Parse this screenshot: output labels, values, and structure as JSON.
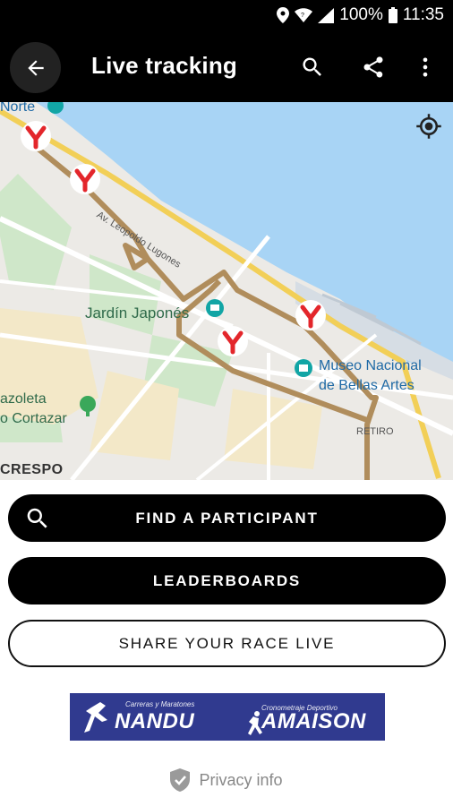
{
  "status_bar": {
    "battery": "100%",
    "time": "11:35",
    "icons": [
      "location-icon",
      "wifi-icon",
      "signal-icon",
      "battery-icon"
    ]
  },
  "app_bar": {
    "title": "Live tracking",
    "actions": [
      "back-icon",
      "search-icon",
      "share-icon",
      "more-vert-icon"
    ]
  },
  "map": {
    "labels": {
      "norte": "Norte",
      "avenue": "Av. Leopoldo Lugones",
      "jardin": "Jardín Japonés",
      "museo_line1": "Museo Nacional",
      "museo_line2": "de Bellas Artes",
      "plazoleta": "azoleta",
      "cortazar": "o Cortazar",
      "retiro": "RETIRO",
      "crespo": "CRESPO"
    },
    "route_color": "#b08d5c",
    "water_color": "#a8d4f5",
    "marker_color": "#e3262b"
  },
  "buttons": {
    "find_participant": "FIND A PARTICIPANT",
    "leaderboards": "LEADERBOARDS",
    "share_race": "SHARE YOUR RACE LIVE"
  },
  "sponsor": {
    "left_small": "Carreras y Maratones",
    "left_big": "NANDU",
    "right_small": "Cronometraje Deportivo",
    "right_big": "AMAISON",
    "background": "#303a8f"
  },
  "privacy": {
    "label": "Privacy info"
  }
}
